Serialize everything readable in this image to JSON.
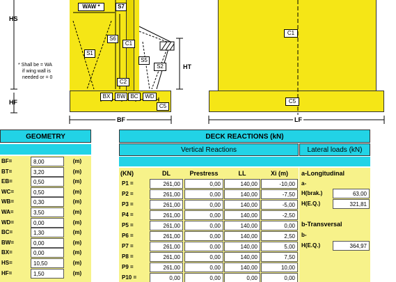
{
  "drawing": {
    "left_labels": {
      "hs": "HS",
      "hf": "HF"
    },
    "waw": "WAW *",
    "s7": "S7",
    "s6": "S6",
    "c1": "C1",
    "s1": "S1",
    "s5": "S5",
    "s2": "S2",
    "c2": "C2",
    "c5": "C5",
    "ht": "HT",
    "bf": "BF",
    "bottom_labels": [
      "BX",
      "BW",
      "BC",
      "WD"
    ],
    "note": [
      "* Shall  be = WA",
      "if wing wall is",
      "needed  or = 0"
    ],
    "right_c1": "C1",
    "right_c5": "C5",
    "lf": "LF"
  },
  "geometry": {
    "title": "GEOMETRY",
    "rows": [
      {
        "label": "BF=",
        "value": "8,00",
        "unit": "(m)"
      },
      {
        "label": "BT=",
        "value": "3,20",
        "unit": "(m)"
      },
      {
        "label": "EB=",
        "value": "0,50",
        "unit": "(m)"
      },
      {
        "label": "WC=",
        "value": "0,50",
        "unit": "(m)"
      },
      {
        "label": "WB=",
        "value": "0,30",
        "unit": "(m)"
      },
      {
        "label": "WA=",
        "value": "3,50",
        "unit": "(m)"
      },
      {
        "label": "WD=",
        "value": "0,00",
        "unit": "(m)"
      },
      {
        "label": "BC=",
        "value": "1,30",
        "unit": "(m)"
      },
      {
        "label": "BW=",
        "value": "0,00",
        "unit": "(m)"
      },
      {
        "label": "BX=",
        "value": "0,00",
        "unit": "(m)"
      },
      {
        "label": "HS=",
        "value": "10,50",
        "unit": "(m)"
      },
      {
        "label": "HF=",
        "value": "1,50",
        "unit": "(m)"
      }
    ]
  },
  "deck": {
    "title": "DECK REACTIONS (kN)",
    "vertical_title": "Vertical Reactions",
    "lateral_title": "Lateral loads (kN)",
    "columns": [
      "(KN)",
      "DL",
      "Prestress",
      "LL",
      "Xi (m)"
    ],
    "rows": [
      {
        "label": "P1 =",
        "dl": "261,00",
        "pre": "0,00",
        "ll": "140,00",
        "xi": "-10,00"
      },
      {
        "label": "P2 =",
        "dl": "261,00",
        "pre": "0,00",
        "ll": "140,00",
        "xi": "-7,50"
      },
      {
        "label": "P3 =",
        "dl": "261,00",
        "pre": "0,00",
        "ll": "140,00",
        "xi": "-5,00"
      },
      {
        "label": "P4 =",
        "dl": "261,00",
        "pre": "0,00",
        "ll": "140,00",
        "xi": "-2,50"
      },
      {
        "label": "P5 =",
        "dl": "261,00",
        "pre": "0,00",
        "ll": "140,00",
        "xi": "0,00"
      },
      {
        "label": "P6 =",
        "dl": "261,00",
        "pre": "0,00",
        "ll": "140,00",
        "xi": "2,50"
      },
      {
        "label": "P7 =",
        "dl": "261,00",
        "pre": "0,00",
        "ll": "140,00",
        "xi": "5,00"
      },
      {
        "label": "P8 =",
        "dl": "261,00",
        "pre": "0,00",
        "ll": "140,00",
        "xi": "7,50"
      },
      {
        "label": "P9 =",
        "dl": "261,00",
        "pre": "0,00",
        "ll": "140,00",
        "xi": "10,00"
      },
      {
        "label": "P10 =",
        "dl": "0,00",
        "pre": "0,00",
        "ll": "0,00",
        "xi": "0,00"
      }
    ],
    "lateral": {
      "longitudinal": "a-Longitudinal",
      "a": "a-",
      "hbrak_label": "H(brak.)",
      "hbrak_value": "63,00",
      "heq_label": "H(E.Q.)",
      "heq_value": "321,81",
      "transversal": "b-Transversal",
      "b": "b-",
      "heq2_label": "H(E.Q.)",
      "heq2_value": "364,97"
    }
  },
  "colors": {
    "yellow": "#f5e616",
    "cyan": "#22d3e6"
  }
}
